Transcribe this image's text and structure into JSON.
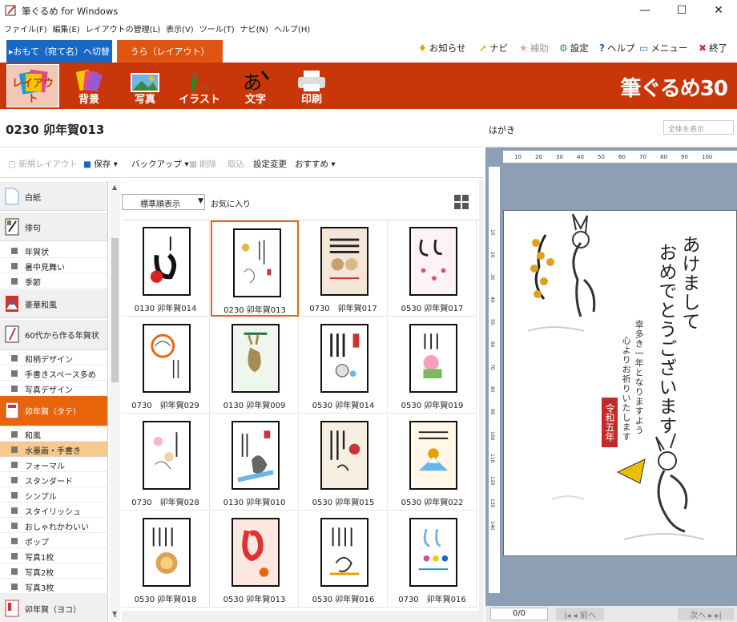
{
  "window": {
    "title": "筆ぐるめ for Windows"
  },
  "menu": [
    "ファイル(F)",
    "編集(E)",
    "レイアウトの管理(L)",
    "表示(V)",
    "ツール(T)",
    "ナビ(N)",
    "ヘルプ(H)"
  ],
  "tabs": {
    "front": "▸おもて（宛て名）へ切替",
    "back": "うら（レイアウト）"
  },
  "topnav": {
    "news": "お知らせ",
    "navi": "ナビ",
    "assist": "補助",
    "settings": "設定",
    "help": "ヘルプ",
    "menu": "メニュー",
    "exit": "終了"
  },
  "toolbar": {
    "layout": "レイアウト",
    "background": "背景",
    "photo": "写真",
    "illust": "イラスト",
    "text": "文字",
    "print": "印刷",
    "brand": "筆ぐるめ30"
  },
  "doc": {
    "title": "0230 卯年賀013"
  },
  "actions": {
    "new": "新規レイアウト",
    "save": "保存",
    "backup": "バックアップ",
    "delete": "削除",
    "undo": "取込",
    "settings_change": "設定変更",
    "recommend": "おすすめ"
  },
  "categories": {
    "blank": "白紙",
    "haiku": "俳句",
    "haiku_subs": [
      "年賀状",
      "暑中見舞い",
      "季節"
    ],
    "gorgeous": "豪華和風",
    "sixties": "60代から作る年賀状",
    "sixties_subs": [
      "和柄デザイン",
      "手書きスペース多め",
      "写真デザイン"
    ],
    "usagi_tate": "卯年賀（タテ）",
    "usagi_subs": [
      "和風",
      "水墨画・手書き",
      "フォーマル",
      "スタンダード",
      "シンプル",
      "スタイリッシュ",
      "おしゃれかわいい",
      "ポップ",
      "写真1枚",
      "写真2枚",
      "写真3枚"
    ],
    "usagi_yoko": "卯年賀（ヨコ）"
  },
  "grid": {
    "sort": "標準順表示",
    "favorites": "お気に入り",
    "items": [
      "0130 卯年賀014",
      "0230 卯年賀013",
      "0730　卯年賀017",
      "0530 卯年賀017",
      "0730　卯年賀029",
      "0130 卯年賀009",
      "0530 卯年賀014",
      "0530 卯年賀019",
      "0730　卯年賀028",
      "0130 卯年賀010",
      "0530 卯年賀015",
      "0530 卯年賀022",
      "0530 卯年賀018",
      "0530 卯年賀013",
      "0530 卯年賀016",
      "0730　卯年賀016"
    ]
  },
  "preview": {
    "label": "はがき",
    "zoom": "全体を表示",
    "ruler_ticks": [
      "10",
      "20",
      "30",
      "40",
      "50",
      "60",
      "70",
      "80",
      "90",
      "100"
    ],
    "ruler_left_ticks": [
      "10",
      "20",
      "30",
      "40",
      "50",
      "60",
      "70",
      "80",
      "90",
      "100",
      "110",
      "120",
      "130",
      "140"
    ],
    "greeting_col1": "あけまして",
    "greeting_col2": "おめでとうございます",
    "message_col1": "幸多き一年となりますよう",
    "message_col2": "心よりお祈りいたします",
    "stamp": "令和五年",
    "page": "0/0",
    "prev": "前へ",
    "next": "次へ"
  }
}
